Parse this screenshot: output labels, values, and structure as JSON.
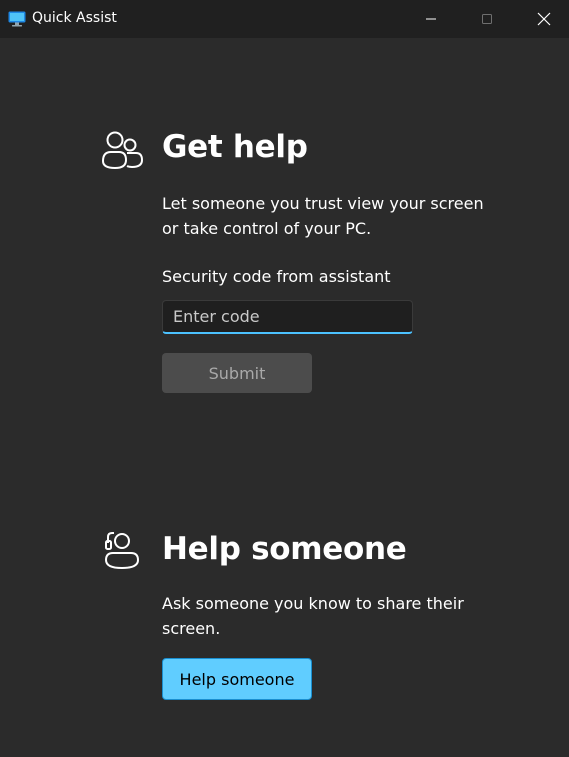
{
  "window": {
    "title": "Quick Assist",
    "controls": [
      "minimize-icon",
      "maximize-icon",
      "close-icon"
    ]
  },
  "get_help": {
    "icon": "people-icon",
    "title": "Get help",
    "description": "Let someone you trust view your screen or take control of your PC.",
    "code_label": "Security code from assistant",
    "code_value": "",
    "code_placeholder": "Enter code",
    "submit_label": "Submit"
  },
  "help_someone": {
    "icon": "person-headset-icon",
    "title": "Help someone",
    "description": "Ask someone you know to share their screen.",
    "button_label": "Help someone"
  },
  "colors": {
    "background": "#2b2b2b",
    "titlebar": "#202020",
    "accent": "#60cdff",
    "input_focus_border": "#4cc2ff",
    "disabled_button": "#4c4c4c"
  }
}
